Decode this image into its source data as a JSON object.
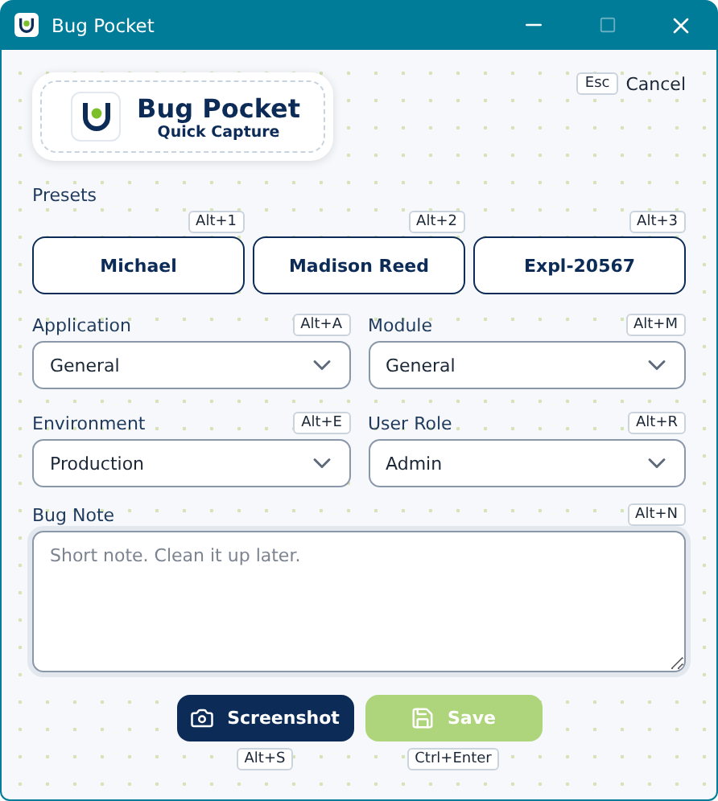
{
  "window": {
    "title": "Bug Pocket"
  },
  "brand": {
    "title": "Bug Pocket",
    "subtitle": "Quick Capture"
  },
  "cancel": {
    "key": "Esc",
    "label": "Cancel"
  },
  "presets": {
    "label": "Presets",
    "items": [
      {
        "label": "Michael",
        "shortcut": "Alt+1"
      },
      {
        "label": "Madison Reed",
        "shortcut": "Alt+2"
      },
      {
        "label": "Expl-20567",
        "shortcut": "Alt+3"
      }
    ]
  },
  "fields": [
    {
      "label": "Application",
      "shortcut": "Alt+A",
      "value": "General"
    },
    {
      "label": "Module",
      "shortcut": "Alt+M",
      "value": "General"
    },
    {
      "label": "Environment",
      "shortcut": "Alt+E",
      "value": "Production"
    },
    {
      "label": "User Role",
      "shortcut": "Alt+R",
      "value": "Admin"
    }
  ],
  "note": {
    "label": "Bug Note",
    "shortcut": "Alt+N",
    "placeholder": "Short note. Clean it up later."
  },
  "actions": [
    {
      "kind": "screenshot",
      "label": "Screenshot",
      "shortcut": "Alt+S",
      "disabled": false
    },
    {
      "kind": "save",
      "label": "Save",
      "shortcut": "Ctrl+Enter",
      "disabled": true
    }
  ]
}
